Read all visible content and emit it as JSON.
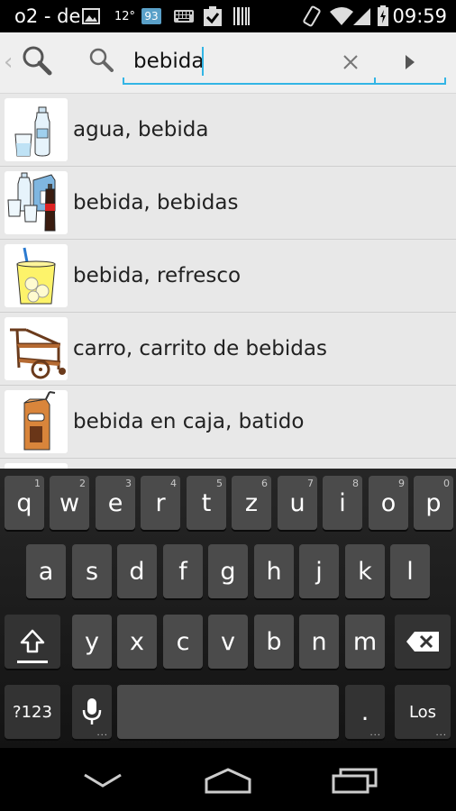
{
  "status_bar": {
    "carrier": "o2 - de",
    "temperature": "12°",
    "badge": "93",
    "time": "09:59",
    "icons": [
      "image-icon",
      "keyboard-icon",
      "checkbox-icon",
      "barcode-icon",
      "vibrate-icon",
      "wifi-icon",
      "signal-icon",
      "battery-charging-icon"
    ]
  },
  "search": {
    "query": "bebida",
    "accent_color": "#33b5e5"
  },
  "results": [
    {
      "label": "agua, bebida",
      "pictogram": "water-glass-bottle"
    },
    {
      "label": "bebida, bebidas",
      "pictogram": "drinks-assortment"
    },
    {
      "label": "bebida, refresco",
      "pictogram": "lemonade-glass"
    },
    {
      "label": "carro, carrito de bebidas",
      "pictogram": "drinks-trolley"
    },
    {
      "label": "bebida en caja, batido",
      "pictogram": "carton-drink"
    }
  ],
  "keyboard": {
    "row1": [
      {
        "key": "q",
        "hint": "1"
      },
      {
        "key": "w",
        "hint": "2"
      },
      {
        "key": "e",
        "hint": "3"
      },
      {
        "key": "r",
        "hint": "4"
      },
      {
        "key": "t",
        "hint": "5"
      },
      {
        "key": "z",
        "hint": "6"
      },
      {
        "key": "u",
        "hint": "7"
      },
      {
        "key": "i",
        "hint": "8"
      },
      {
        "key": "o",
        "hint": "9"
      },
      {
        "key": "p",
        "hint": "0"
      }
    ],
    "row2": [
      "a",
      "s",
      "d",
      "f",
      "g",
      "h",
      "j",
      "k",
      "l"
    ],
    "row3": [
      "y",
      "x",
      "c",
      "v",
      "b",
      "n",
      "m"
    ],
    "symbols_label": "?123",
    "period_label": ".",
    "action_label": "Los"
  },
  "nav": {
    "buttons": [
      "back-icon",
      "home-icon",
      "recents-icon"
    ]
  }
}
